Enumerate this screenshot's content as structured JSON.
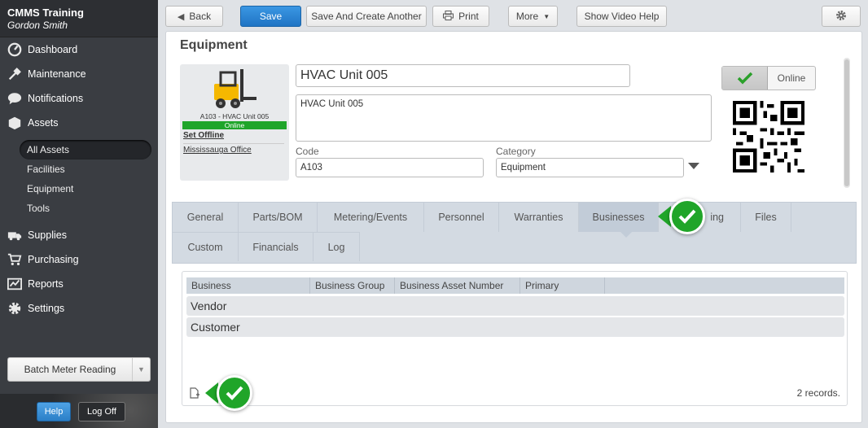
{
  "sidebar": {
    "app_name": "CMMS Training",
    "user_name": "Gordon Smith",
    "nav": {
      "dashboard": "Dashboard",
      "maintenance": "Maintenance",
      "notifications": "Notifications",
      "assets": "Assets",
      "supplies": "Supplies",
      "purchasing": "Purchasing",
      "reports": "Reports",
      "settings": "Settings"
    },
    "asset_subitems": [
      "All Assets",
      "Facilities",
      "Equipment",
      "Tools"
    ],
    "active_subitem": "All Assets",
    "batch_button": "Batch Meter Reading",
    "help_button": "Help",
    "logoff_button": "Log Off"
  },
  "toolbar": {
    "back": "Back",
    "save": "Save",
    "save_create": "Save And Create Another",
    "print": "Print",
    "more": "More",
    "video_help": "Show Video Help"
  },
  "record": {
    "section_title": "Equipment",
    "card_caption": "A103 - HVAC Unit 005",
    "status": "Online",
    "set_offline": "Set Offline",
    "location": "Mississauga Office",
    "name": "HVAC Unit 005",
    "description": "HVAC Unit 005",
    "code_label": "Code",
    "code_value": "A103",
    "category_label": "Category",
    "category_value": "Equipment",
    "online_toggle_label": "Online"
  },
  "tabs": {
    "row1": [
      "General",
      "Parts/BOM",
      "Metering/Events",
      "Personnel",
      "Warranties",
      "Businesses",
      "ing",
      "Files"
    ],
    "row2": [
      "Custom",
      "Financials",
      "Log"
    ],
    "active": "Businesses"
  },
  "grid": {
    "columns": [
      "Business",
      "Business Group",
      "Business Asset Number",
      "Primary"
    ],
    "groups": [
      "Vendor",
      "Customer"
    ],
    "records_text": "2 records."
  },
  "colors": {
    "accent_blue": "#2b84d3",
    "online_green": "#1fa52a",
    "callout_green": "#20a529",
    "sidebar_bg": "#3a3d42"
  }
}
